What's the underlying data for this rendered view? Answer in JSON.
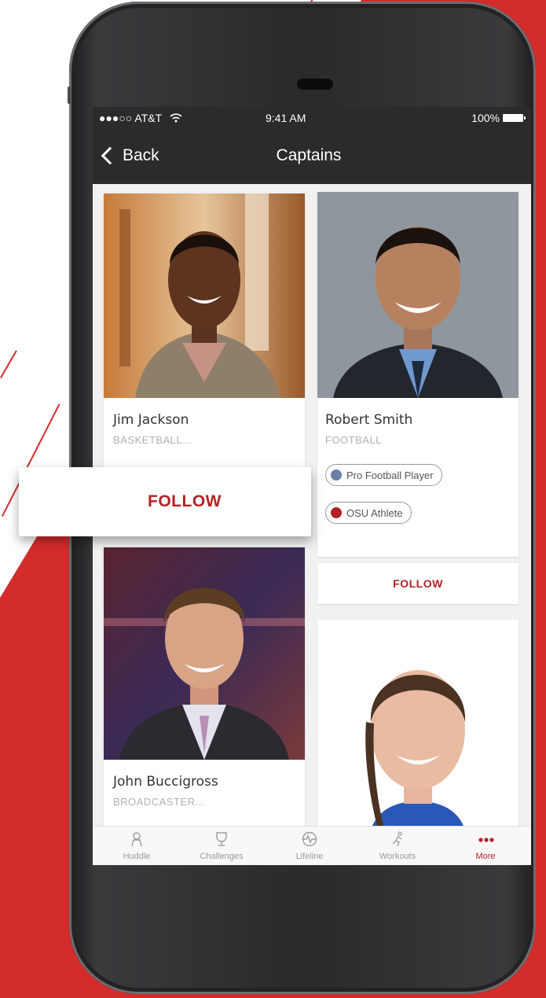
{
  "status_bar": {
    "carrier": "●●●○○ AT&T",
    "wifi": "wifi",
    "time": "9:41 AM",
    "battery": "100%"
  },
  "nav": {
    "back_label": "Back",
    "title": "Captains"
  },
  "cards": [
    {
      "name": "Jim Jackson",
      "sport": "BASKETBALL...",
      "follow": "FOLLOW"
    },
    {
      "name": "Robert Smith",
      "sport": "FOOTBALL",
      "badges": [
        "Pro Football Player",
        "OSU Athlete"
      ],
      "follow": "FOLLOW"
    },
    {
      "name": "John Buccigross",
      "sport": "BROADCASTER..."
    },
    {
      "name": ""
    }
  ],
  "floating_follow": "FOLLOW",
  "tabs": [
    {
      "label": "Huddle",
      "icon": "huddle-icon"
    },
    {
      "label": "Challenges",
      "icon": "trophy-icon"
    },
    {
      "label": "Lifeline",
      "icon": "lifeline-icon"
    },
    {
      "label": "Workouts",
      "icon": "runner-icon"
    },
    {
      "label": "More",
      "icon": "more-dots-icon",
      "active": true
    }
  ],
  "colors": {
    "brand_red": "#b22222",
    "background_red": "#d42b2b",
    "nav_dark": "#2b2b2b"
  }
}
